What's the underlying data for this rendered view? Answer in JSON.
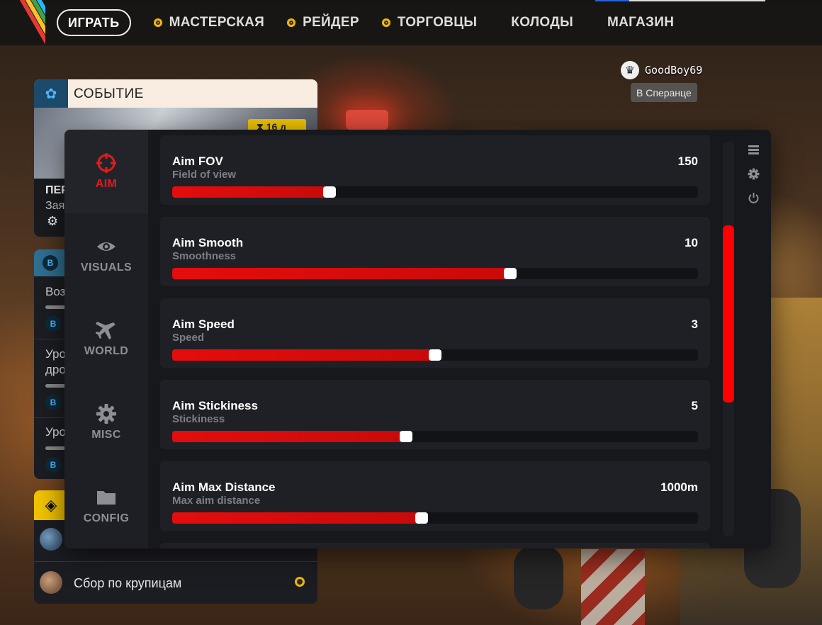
{
  "nav": {
    "play": "ИГРАТЬ",
    "items": [
      {
        "label": "МАСТЕРСКАЯ",
        "dot": true
      },
      {
        "label": "РЕЙДЕР",
        "dot": true
      },
      {
        "label": "ТОРГОВЦЫ",
        "dot": true
      },
      {
        "label": "КОЛОДЫ",
        "dot": false
      },
      {
        "label": "МАГАЗИН",
        "dot": false
      }
    ]
  },
  "user": {
    "name": "GoodBoy69",
    "status": "В Сперанце",
    "avatar_icon": "crown-icon"
  },
  "event": {
    "header": "СОБЫТИЕ",
    "badge": "⧗ 16 д",
    "title_partial": "ПЕР",
    "subtitle_partial": "Зая"
  },
  "quests": {
    "items": [
      {
        "text": "Воз"
      },
      {
        "text": "Уро",
        "text2": "дро"
      },
      {
        "text": "Уро"
      }
    ]
  },
  "trials": {
    "item": "Сбор по крупицам"
  },
  "cheat": {
    "tabs": [
      {
        "label": "AIM",
        "icon": "crosshair-icon",
        "active": true
      },
      {
        "label": "VISUALS",
        "icon": "eye-icon",
        "active": false
      },
      {
        "label": "WORLD",
        "icon": "plane-icon",
        "active": false
      },
      {
        "label": "MISC",
        "icon": "gear-icon",
        "active": false
      },
      {
        "label": "CONFIG",
        "icon": "folder-icon",
        "active": false
      }
    ],
    "sliders": [
      {
        "title": "Aim FOV",
        "subtitle": "Field of view",
        "value": "150",
        "fill": 0.299
      },
      {
        "title": "Aim Smooth",
        "subtitle": "Smoothness",
        "value": "10",
        "fill": 0.643
      },
      {
        "title": "Aim Speed",
        "subtitle": "Speed",
        "value": "3",
        "fill": 0.5
      },
      {
        "title": "Aim Stickiness",
        "subtitle": "Stickiness",
        "value": "5",
        "fill": 0.445
      },
      {
        "title": "Aim Max Distance",
        "subtitle": "Max aim distance",
        "value": "1000m",
        "fill": 0.474
      }
    ],
    "tools": [
      "list-icon",
      "gear-icon",
      "power-icon"
    ],
    "accent": "#ff0000"
  }
}
